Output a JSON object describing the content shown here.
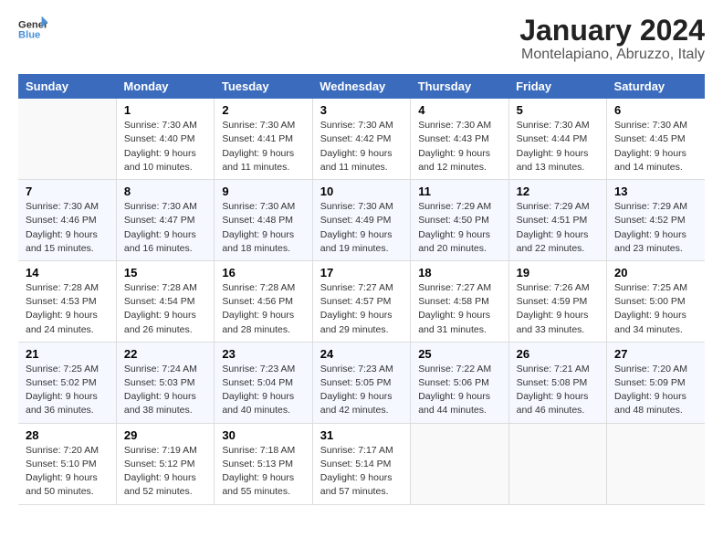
{
  "logo": {
    "text_general": "General",
    "text_blue": "Blue"
  },
  "title": "January 2024",
  "subtitle": "Montelapiano, Abruzzo, Italy",
  "calendar": {
    "headers": [
      "Sunday",
      "Monday",
      "Tuesday",
      "Wednesday",
      "Thursday",
      "Friday",
      "Saturday"
    ],
    "weeks": [
      [
        {
          "day": "",
          "sunrise": "",
          "sunset": "",
          "daylight": ""
        },
        {
          "day": "1",
          "sunrise": "Sunrise: 7:30 AM",
          "sunset": "Sunset: 4:40 PM",
          "daylight": "Daylight: 9 hours and 10 minutes."
        },
        {
          "day": "2",
          "sunrise": "Sunrise: 7:30 AM",
          "sunset": "Sunset: 4:41 PM",
          "daylight": "Daylight: 9 hours and 11 minutes."
        },
        {
          "day": "3",
          "sunrise": "Sunrise: 7:30 AM",
          "sunset": "Sunset: 4:42 PM",
          "daylight": "Daylight: 9 hours and 11 minutes."
        },
        {
          "day": "4",
          "sunrise": "Sunrise: 7:30 AM",
          "sunset": "Sunset: 4:43 PM",
          "daylight": "Daylight: 9 hours and 12 minutes."
        },
        {
          "day": "5",
          "sunrise": "Sunrise: 7:30 AM",
          "sunset": "Sunset: 4:44 PM",
          "daylight": "Daylight: 9 hours and 13 minutes."
        },
        {
          "day": "6",
          "sunrise": "Sunrise: 7:30 AM",
          "sunset": "Sunset: 4:45 PM",
          "daylight": "Daylight: 9 hours and 14 minutes."
        }
      ],
      [
        {
          "day": "7",
          "sunrise": "Sunrise: 7:30 AM",
          "sunset": "Sunset: 4:46 PM",
          "daylight": "Daylight: 9 hours and 15 minutes."
        },
        {
          "day": "8",
          "sunrise": "Sunrise: 7:30 AM",
          "sunset": "Sunset: 4:47 PM",
          "daylight": "Daylight: 9 hours and 16 minutes."
        },
        {
          "day": "9",
          "sunrise": "Sunrise: 7:30 AM",
          "sunset": "Sunset: 4:48 PM",
          "daylight": "Daylight: 9 hours and 18 minutes."
        },
        {
          "day": "10",
          "sunrise": "Sunrise: 7:30 AM",
          "sunset": "Sunset: 4:49 PM",
          "daylight": "Daylight: 9 hours and 19 minutes."
        },
        {
          "day": "11",
          "sunrise": "Sunrise: 7:29 AM",
          "sunset": "Sunset: 4:50 PM",
          "daylight": "Daylight: 9 hours and 20 minutes."
        },
        {
          "day": "12",
          "sunrise": "Sunrise: 7:29 AM",
          "sunset": "Sunset: 4:51 PM",
          "daylight": "Daylight: 9 hours and 22 minutes."
        },
        {
          "day": "13",
          "sunrise": "Sunrise: 7:29 AM",
          "sunset": "Sunset: 4:52 PM",
          "daylight": "Daylight: 9 hours and 23 minutes."
        }
      ],
      [
        {
          "day": "14",
          "sunrise": "Sunrise: 7:28 AM",
          "sunset": "Sunset: 4:53 PM",
          "daylight": "Daylight: 9 hours and 24 minutes."
        },
        {
          "day": "15",
          "sunrise": "Sunrise: 7:28 AM",
          "sunset": "Sunset: 4:54 PM",
          "daylight": "Daylight: 9 hours and 26 minutes."
        },
        {
          "day": "16",
          "sunrise": "Sunrise: 7:28 AM",
          "sunset": "Sunset: 4:56 PM",
          "daylight": "Daylight: 9 hours and 28 minutes."
        },
        {
          "day": "17",
          "sunrise": "Sunrise: 7:27 AM",
          "sunset": "Sunset: 4:57 PM",
          "daylight": "Daylight: 9 hours and 29 minutes."
        },
        {
          "day": "18",
          "sunrise": "Sunrise: 7:27 AM",
          "sunset": "Sunset: 4:58 PM",
          "daylight": "Daylight: 9 hours and 31 minutes."
        },
        {
          "day": "19",
          "sunrise": "Sunrise: 7:26 AM",
          "sunset": "Sunset: 4:59 PM",
          "daylight": "Daylight: 9 hours and 33 minutes."
        },
        {
          "day": "20",
          "sunrise": "Sunrise: 7:25 AM",
          "sunset": "Sunset: 5:00 PM",
          "daylight": "Daylight: 9 hours and 34 minutes."
        }
      ],
      [
        {
          "day": "21",
          "sunrise": "Sunrise: 7:25 AM",
          "sunset": "Sunset: 5:02 PM",
          "daylight": "Daylight: 9 hours and 36 minutes."
        },
        {
          "day": "22",
          "sunrise": "Sunrise: 7:24 AM",
          "sunset": "Sunset: 5:03 PM",
          "daylight": "Daylight: 9 hours and 38 minutes."
        },
        {
          "day": "23",
          "sunrise": "Sunrise: 7:23 AM",
          "sunset": "Sunset: 5:04 PM",
          "daylight": "Daylight: 9 hours and 40 minutes."
        },
        {
          "day": "24",
          "sunrise": "Sunrise: 7:23 AM",
          "sunset": "Sunset: 5:05 PM",
          "daylight": "Daylight: 9 hours and 42 minutes."
        },
        {
          "day": "25",
          "sunrise": "Sunrise: 7:22 AM",
          "sunset": "Sunset: 5:06 PM",
          "daylight": "Daylight: 9 hours and 44 minutes."
        },
        {
          "day": "26",
          "sunrise": "Sunrise: 7:21 AM",
          "sunset": "Sunset: 5:08 PM",
          "daylight": "Daylight: 9 hours and 46 minutes."
        },
        {
          "day": "27",
          "sunrise": "Sunrise: 7:20 AM",
          "sunset": "Sunset: 5:09 PM",
          "daylight": "Daylight: 9 hours and 48 minutes."
        }
      ],
      [
        {
          "day": "28",
          "sunrise": "Sunrise: 7:20 AM",
          "sunset": "Sunset: 5:10 PM",
          "daylight": "Daylight: 9 hours and 50 minutes."
        },
        {
          "day": "29",
          "sunrise": "Sunrise: 7:19 AM",
          "sunset": "Sunset: 5:12 PM",
          "daylight": "Daylight: 9 hours and 52 minutes."
        },
        {
          "day": "30",
          "sunrise": "Sunrise: 7:18 AM",
          "sunset": "Sunset: 5:13 PM",
          "daylight": "Daylight: 9 hours and 55 minutes."
        },
        {
          "day": "31",
          "sunrise": "Sunrise: 7:17 AM",
          "sunset": "Sunset: 5:14 PM",
          "daylight": "Daylight: 9 hours and 57 minutes."
        },
        {
          "day": "",
          "sunrise": "",
          "sunset": "",
          "daylight": ""
        },
        {
          "day": "",
          "sunrise": "",
          "sunset": "",
          "daylight": ""
        },
        {
          "day": "",
          "sunrise": "",
          "sunset": "",
          "daylight": ""
        }
      ]
    ]
  }
}
